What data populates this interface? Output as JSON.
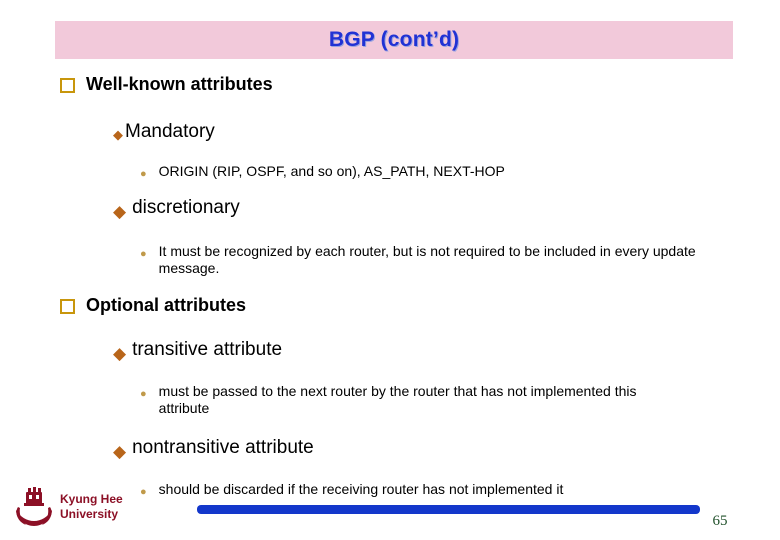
{
  "slide": {
    "title": "BGP (cont’d)",
    "title_banner_color": "#f2c9da",
    "title_text_color": "#2132d4"
  },
  "content": {
    "sections": [
      {
        "heading": "Well-known attributes",
        "marker": "wingdings-square-bullet",
        "children": [
          {
            "label": "Mandatory",
            "marker": "diamond-bullet-small",
            "details": [
              {
                "text": "ORIGIN (RIP, OSPF, and so on), AS_PATH, NEXT-HOP",
                "marker": "round-bullet"
              }
            ]
          },
          {
            "label": "discretionary",
            "marker": "diamond-bullet-large",
            "details": [
              {
                "text": "It must be recognized by each router, but is not required to be included in every update message.",
                "marker": "round-bullet"
              }
            ]
          }
        ]
      },
      {
        "heading": "Optional attributes",
        "marker": "wingdings-square-bullet",
        "children": [
          {
            "label": "transitive attribute",
            "marker": "diamond-bullet-large",
            "details": [
              {
                "text": "must be passed to the next router by the router that has not implemented this attribute",
                "marker": "round-bullet"
              }
            ]
          },
          {
            "label": "nontransitive attribute",
            "marker": "diamond-bullet-large",
            "details": [
              {
                "text": "should be discarded if the receiving router has not implemented it",
                "marker": "round-bullet"
              }
            ]
          }
        ]
      }
    ]
  },
  "footer": {
    "university_line1": "Kyung Hee",
    "university_line2": "University",
    "logo_color": "#8c1026",
    "bar_color": "#1337cb",
    "page_number": "65",
    "page_number_color": "#21512b"
  },
  "glyphs": {
    "diamond": "◆",
    "dot": "●"
  }
}
